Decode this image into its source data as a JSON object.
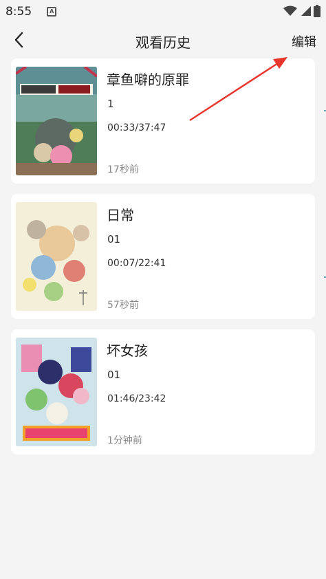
{
  "status_bar": {
    "time": "8:55",
    "notification_icon": "A"
  },
  "header": {
    "back_icon": "chevron-left-icon",
    "title": "观看历史",
    "edit_label": "编辑"
  },
  "history": [
    {
      "title": "章鱼噼的原罪",
      "episode": "1",
      "progress": "00:33/37:47",
      "watched": "17秒前"
    },
    {
      "title": "日常",
      "episode": "01",
      "progress": "00:07/22:41",
      "watched": "57秒前"
    },
    {
      "title": "坏女孩",
      "episode": "01",
      "progress": "01:46/23:42",
      "watched": "1分钟前"
    }
  ],
  "colors": {
    "annotation_arrow": "#e8362c",
    "card_background": "#ffffff",
    "page_background": "#f4f4f4"
  }
}
